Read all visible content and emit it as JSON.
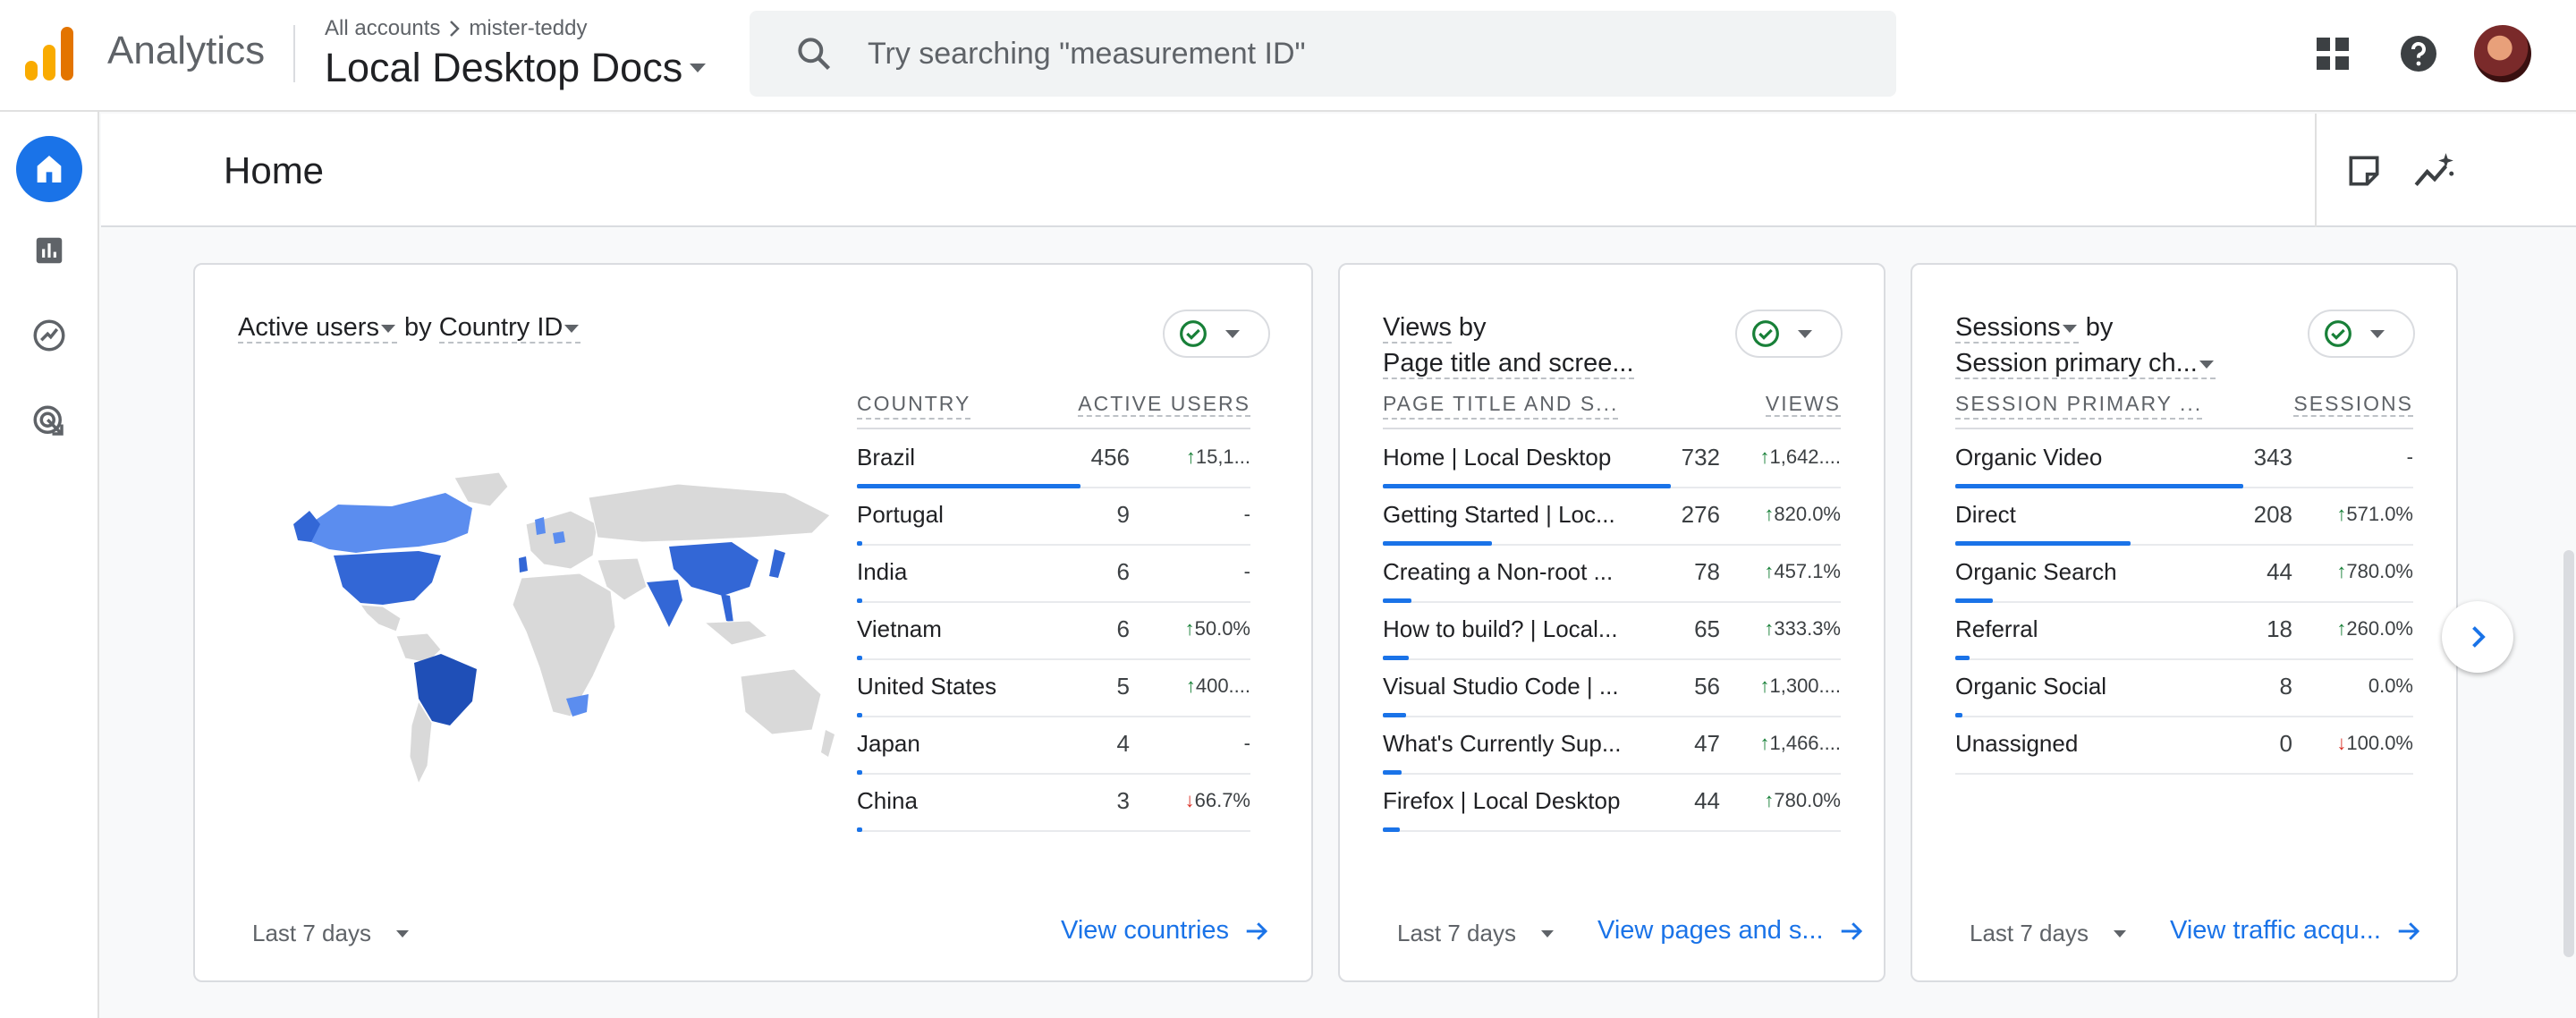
{
  "app": {
    "name": "Analytics",
    "breadcrumb_root": "All accounts",
    "breadcrumb_account": "mister-teddy",
    "property": "Local Desktop Docs"
  },
  "search": {
    "placeholder": "Try searching \"measurement ID\""
  },
  "page": {
    "title": "Home"
  },
  "cards": {
    "countries": {
      "title_metric": "Active users",
      "title_by": "by",
      "title_dim": "Country ID",
      "col1": "COUNTRY",
      "col2": "ACTIVE USERS",
      "rows": [
        {
          "label": "Brazil",
          "value": "456",
          "change": "15,1...",
          "dir": "up",
          "share": 1.0
        },
        {
          "label": "Portugal",
          "value": "9",
          "change": "-",
          "dir": "none",
          "share": 0.02
        },
        {
          "label": "India",
          "value": "6",
          "change": "-",
          "dir": "none",
          "share": 0.015
        },
        {
          "label": "Vietnam",
          "value": "6",
          "change": "50.0%",
          "dir": "up",
          "share": 0.015
        },
        {
          "label": "United States",
          "value": "5",
          "change": "400....",
          "dir": "up",
          "share": 0.012
        },
        {
          "label": "Japan",
          "value": "4",
          "change": "-",
          "dir": "none",
          "share": 0.01
        },
        {
          "label": "China",
          "value": "3",
          "change": "66.7%",
          "dir": "down",
          "share": 0.008
        }
      ],
      "date_range": "Last 7 days",
      "link": "View countries"
    },
    "pages": {
      "title_metric": "Views",
      "title_by": "by",
      "title_dim": "Page title and scree...",
      "col1": "PAGE TITLE AND S...",
      "col2": "VIEWS",
      "rows": [
        {
          "label": "Home | Local Desktop",
          "value": "732",
          "change": "1,642....",
          "dir": "up",
          "share": 1.0
        },
        {
          "label": "Getting Started | Loc...",
          "value": "276",
          "change": "820.0%",
          "dir": "up",
          "share": 0.38
        },
        {
          "label": "Creating a Non-root ...",
          "value": "78",
          "change": "457.1%",
          "dir": "up",
          "share": 0.1
        },
        {
          "label": "How to build? | Local...",
          "value": "65",
          "change": "333.3%",
          "dir": "up",
          "share": 0.09
        },
        {
          "label": "Visual Studio Code | ...",
          "value": "56",
          "change": "1,300....",
          "dir": "up",
          "share": 0.08
        },
        {
          "label": "What's Currently Sup...",
          "value": "47",
          "change": "1,466....",
          "dir": "up",
          "share": 0.065
        },
        {
          "label": "Firefox | Local Desktop",
          "value": "44",
          "change": "780.0%",
          "dir": "up",
          "share": 0.06
        }
      ],
      "date_range": "Last 7 days",
      "link": "View pages and s..."
    },
    "sessions": {
      "title_metric": "Sessions",
      "title_by": "by",
      "title_dim": "Session primary ch...",
      "col1": "SESSION PRIMARY ...",
      "col2": "SESSIONS",
      "rows": [
        {
          "label": "Organic Video",
          "value": "343",
          "change": "-",
          "dir": "none",
          "share": 1.0
        },
        {
          "label": "Direct",
          "value": "208",
          "change": "571.0%",
          "dir": "up",
          "share": 0.61
        },
        {
          "label": "Organic Search",
          "value": "44",
          "change": "780.0%",
          "dir": "up",
          "share": 0.13
        },
        {
          "label": "Referral",
          "value": "18",
          "change": "260.0%",
          "dir": "up",
          "share": 0.05
        },
        {
          "label": "Organic Social",
          "value": "8",
          "change": "0.0%",
          "dir": "none",
          "share": 0.025
        },
        {
          "label": "Unassigned",
          "value": "0",
          "change": "100.0%",
          "dir": "down",
          "share": 0
        }
      ],
      "date_range": "Last 7 days",
      "link": "View traffic acqu..."
    }
  },
  "colors": {
    "accent": "#1a73e8",
    "up": "#188038",
    "down": "#d93025",
    "logo_orange": "#f9ab00",
    "logo_dark": "#e37400"
  },
  "icons": [
    "search-icon",
    "apps-grid-icon",
    "help-icon",
    "home-icon",
    "reports-icon",
    "explore-icon",
    "advertising-icon",
    "insights-note-icon",
    "sparkle-trend-icon",
    "check-circle-icon",
    "chevron-right-icon",
    "arrow-right-icon"
  ]
}
